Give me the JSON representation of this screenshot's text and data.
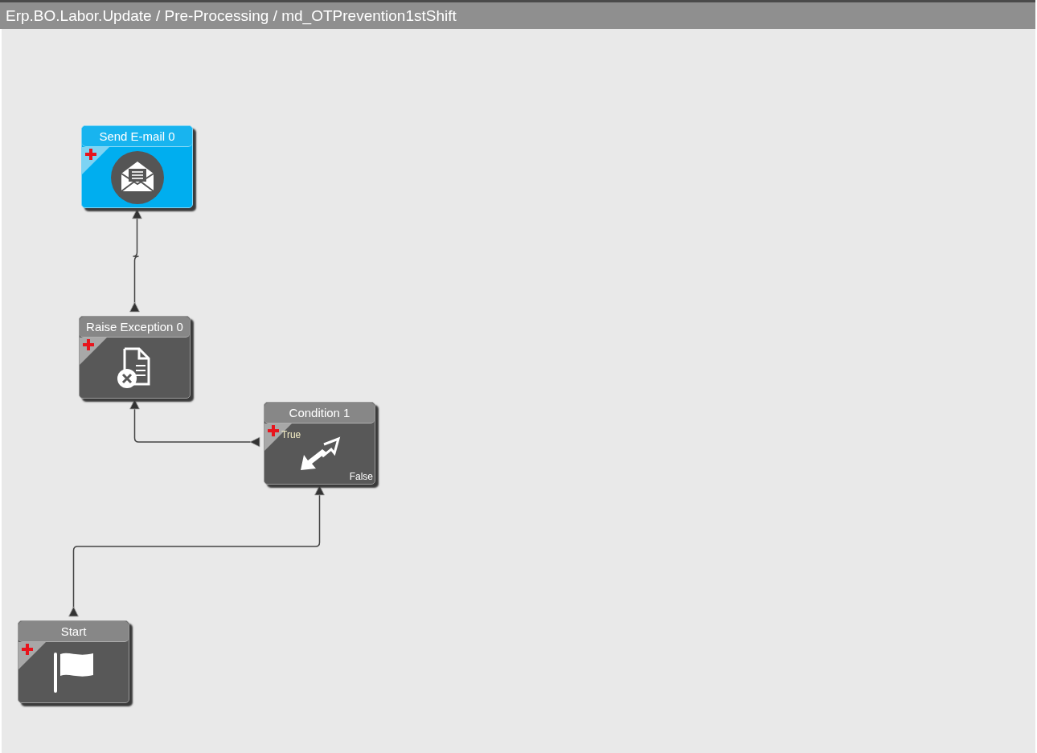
{
  "title_bar": {
    "path": "Erp.BO.Labor.Update / Pre-Processing / md_OTPrevention1stShift"
  },
  "nodes": [
    {
      "title": "Send E-mail 0",
      "kind": "email",
      "selected": true
    },
    {
      "title": "Raise Exception 0",
      "kind": "exception",
      "selected": false
    },
    {
      "title": "Condition 1",
      "kind": "condition",
      "selected": false,
      "true_label": "True",
      "false_label": "False"
    },
    {
      "title": "Start",
      "kind": "start",
      "selected": false
    }
  ]
}
